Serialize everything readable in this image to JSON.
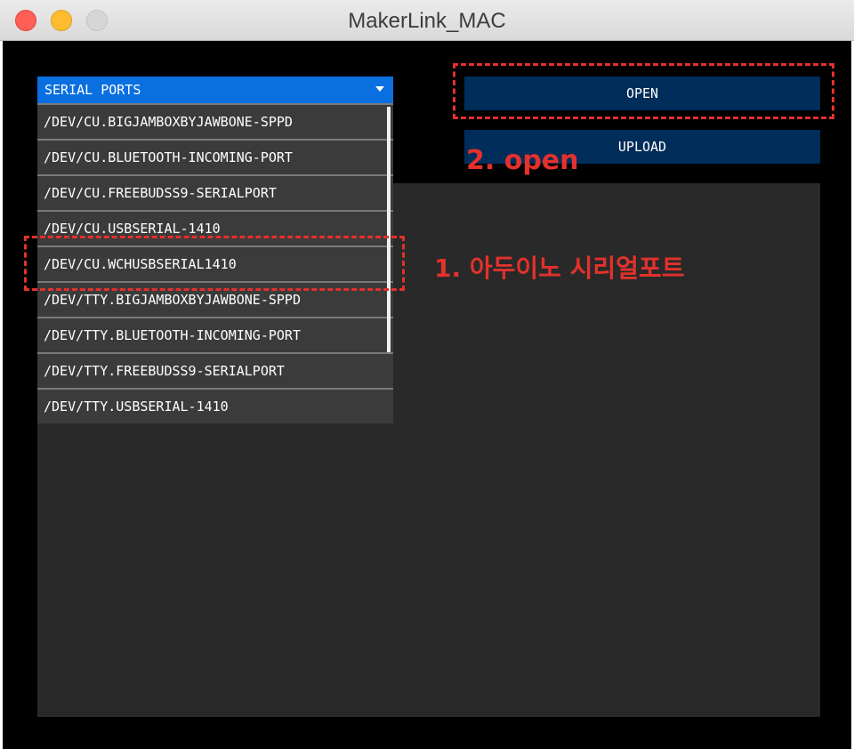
{
  "window": {
    "title": "MakerLink_MAC"
  },
  "dropdown": {
    "label": "SERIAL PORTS",
    "items": [
      "/DEV/CU.BIGJAMBOXBYJAWBONE-SPPD",
      "/DEV/CU.BLUETOOTH-INCOMING-PORT",
      "/DEV/CU.FREEBUDSS9-SERIALPORT",
      "/DEV/CU.USBSERIAL-1410",
      "/DEV/CU.WCHUSBSERIAL1410",
      "/DEV/TTY.BIGJAMBOXBYJAWBONE-SPPD",
      "/DEV/TTY.BLUETOOTH-INCOMING-PORT",
      "/DEV/TTY.FREEBUDSS9-SERIALPORT",
      "/DEV/TTY.USBSERIAL-1410"
    ]
  },
  "buttons": {
    "open": "OPEN",
    "upload": "UPLOAD"
  },
  "annotations": {
    "step1": "1. 아두이노 시리얼포트",
    "step2": "2. open"
  },
  "colors": {
    "accent": "#0a6fe0",
    "button": "#002d5a",
    "annotation": "#e3312c",
    "console": "#292929"
  }
}
